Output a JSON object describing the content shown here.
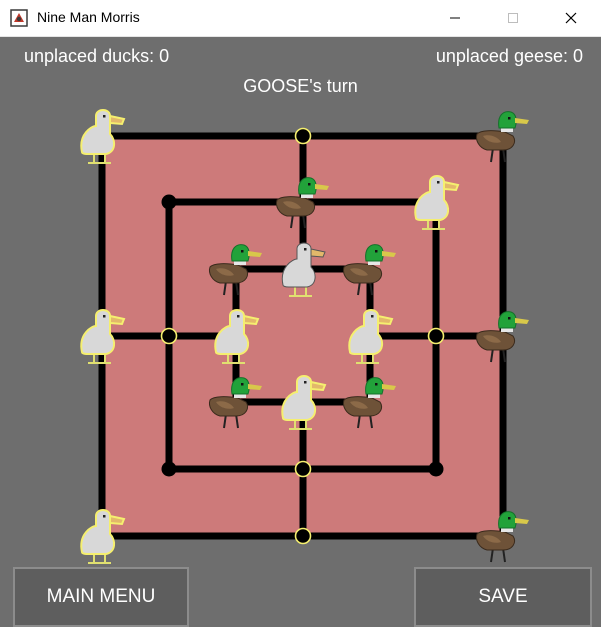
{
  "window": {
    "title": "Nine Man Morris"
  },
  "status": {
    "unplaced_ducks": "unplaced ducks: 0",
    "unplaced_geese": "unplaced geese: 0",
    "turn": "GOOSE's turn"
  },
  "buttons": {
    "main_menu": "MAIN MENU",
    "save": "SAVE"
  },
  "colors": {
    "board": "#cd7a7a",
    "lines": "#000000",
    "highlight": "#f5ef6f",
    "background": "#6e6e6e"
  },
  "pieces": [
    {
      "point": "outer-top-left",
      "type": "goose",
      "highlighted": true
    },
    {
      "point": "outer-top-right",
      "type": "duck",
      "highlighted": false
    },
    {
      "point": "middle-top-mid",
      "type": "duck",
      "highlighted": false
    },
    {
      "point": "middle-top-right",
      "type": "goose",
      "highlighted": true
    },
    {
      "point": "inner-top-left",
      "type": "duck",
      "highlighted": false
    },
    {
      "point": "inner-top-mid",
      "type": "goose",
      "highlighted": false
    },
    {
      "point": "inner-top-right",
      "type": "duck",
      "highlighted": false
    },
    {
      "point": "outer-mid-left",
      "type": "goose",
      "highlighted": true
    },
    {
      "point": "inner-mid-left",
      "type": "goose",
      "highlighted": true
    },
    {
      "point": "inner-mid-right",
      "type": "goose",
      "highlighted": true
    },
    {
      "point": "outer-mid-right",
      "type": "duck",
      "highlighted": false
    },
    {
      "point": "inner-bottom-left",
      "type": "duck",
      "highlighted": false
    },
    {
      "point": "inner-bottom-mid",
      "type": "goose",
      "highlighted": true
    },
    {
      "point": "inner-bottom-right",
      "type": "duck",
      "highlighted": false
    },
    {
      "point": "outer-bottom-left",
      "type": "goose",
      "highlighted": true
    },
    {
      "point": "outer-bottom-right",
      "type": "duck",
      "highlighted": false
    }
  ],
  "empty_points": [
    {
      "point": "outer-top-mid",
      "highlighted": true
    },
    {
      "point": "middle-top-left",
      "highlighted": false
    },
    {
      "point": "middle-mid-left",
      "highlighted": true
    },
    {
      "point": "middle-mid-right",
      "highlighted": true
    },
    {
      "point": "middle-bottom-left",
      "highlighted": false
    },
    {
      "point": "middle-bottom-mid",
      "highlighted": true
    },
    {
      "point": "middle-bottom-right",
      "highlighted": false
    },
    {
      "point": "outer-bottom-mid",
      "highlighted": true
    }
  ]
}
